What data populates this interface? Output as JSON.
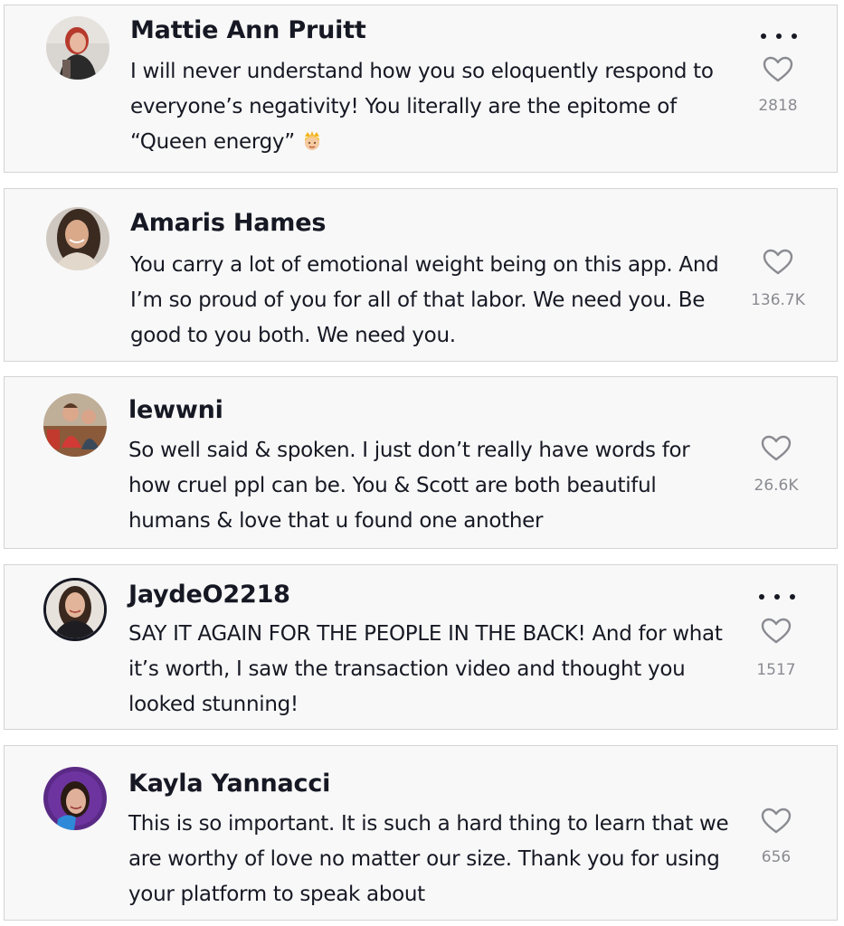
{
  "colors": {
    "text": "#161823",
    "muted": "#8a8b91",
    "card_bg": "#f8f8f8",
    "card_border": "#d4d4d4"
  },
  "comments": [
    {
      "username": "Mattie Ann Pruitt",
      "text": "I will never understand how you so eloquently respond to everyone’s negativity! You literally are the epitome of “Queen energy”",
      "emoji": "princess-emoji",
      "likes": "2818",
      "has_more_menu": true
    },
    {
      "username": "Amaris Hames",
      "text": "You carry a lot of emotional weight being on this app. And I’m so proud of you for all of that labor. We need you. Be good to you both. We need you.",
      "likes": "136.7K",
      "has_more_menu": false
    },
    {
      "username": "lewwni",
      "text": "So well said & spoken. I just don’t really have words for how cruel ppl can be. You & Scott are both beautiful humans & love that u found one another",
      "likes": "26.6K",
      "has_more_menu": false
    },
    {
      "username": "JaydeO2218",
      "text": "SAY IT AGAIN FOR THE PEOPLE IN THE BACK! And for what it’s worth, I saw the transaction video and thought you looked stunning!",
      "likes": "1517",
      "has_more_menu": true
    },
    {
      "username": "Kayla Yannacci",
      "text": "This is so important. It is such a hard thing to learn that we are worthy of love no matter our size. Thank you for using your platform to speak about",
      "likes": "656",
      "has_more_menu": false
    }
  ]
}
